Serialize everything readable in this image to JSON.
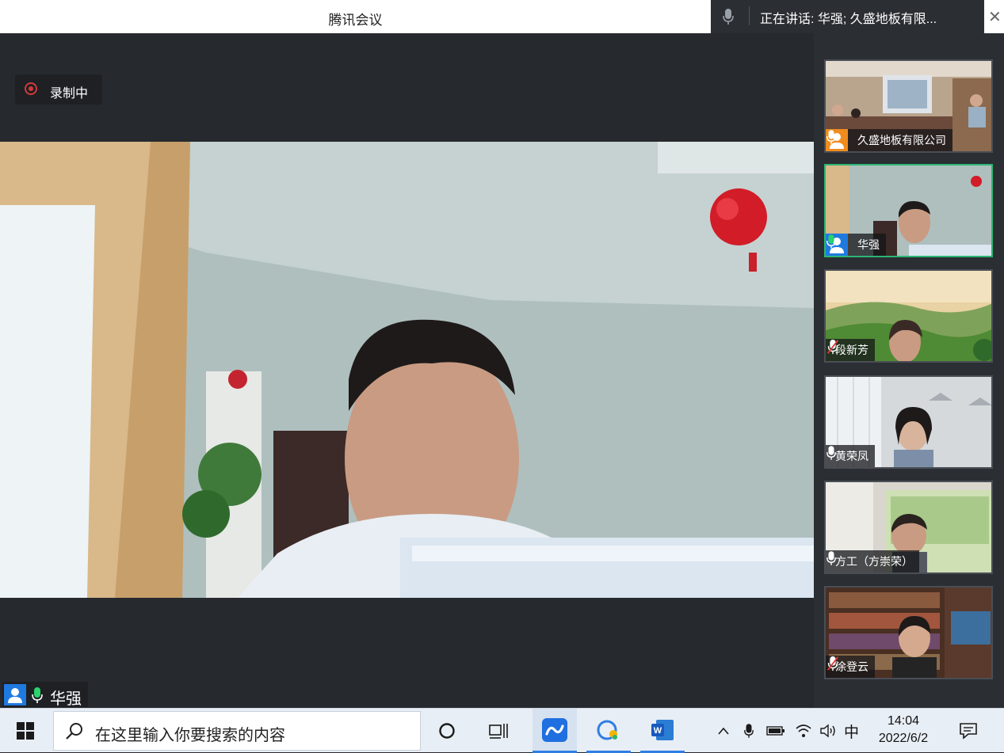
{
  "window": {
    "title": "腾讯会议",
    "close_icon": "close-icon"
  },
  "speaking": {
    "text": "正在讲话: 华强; 久盛地板有限..."
  },
  "recording": {
    "label": "录制中",
    "color": "#d23a3a"
  },
  "main_speaker": {
    "name": "华强"
  },
  "participants": [
    {
      "name": "久盛地板有限公司",
      "avatar_color": "#f08c1e",
      "mic": "on",
      "active": false
    },
    {
      "name": "华强",
      "avatar_color": "#1f7ae0",
      "mic": "speaking",
      "active": true
    },
    {
      "name": "段新芳",
      "mic": "muted",
      "active": false
    },
    {
      "name": "黄荣凤",
      "mic": "on",
      "active": false
    },
    {
      "name": "方工（方崇荣）",
      "mic": "on",
      "active": false
    },
    {
      "name": "涂登云",
      "mic": "muted",
      "active": false
    }
  ],
  "taskbar": {
    "search_placeholder": "在这里输入你要搜索的内容",
    "ime": "中",
    "time": "14:04",
    "date": "2022/6/2",
    "accent": "#2f7ee5"
  }
}
